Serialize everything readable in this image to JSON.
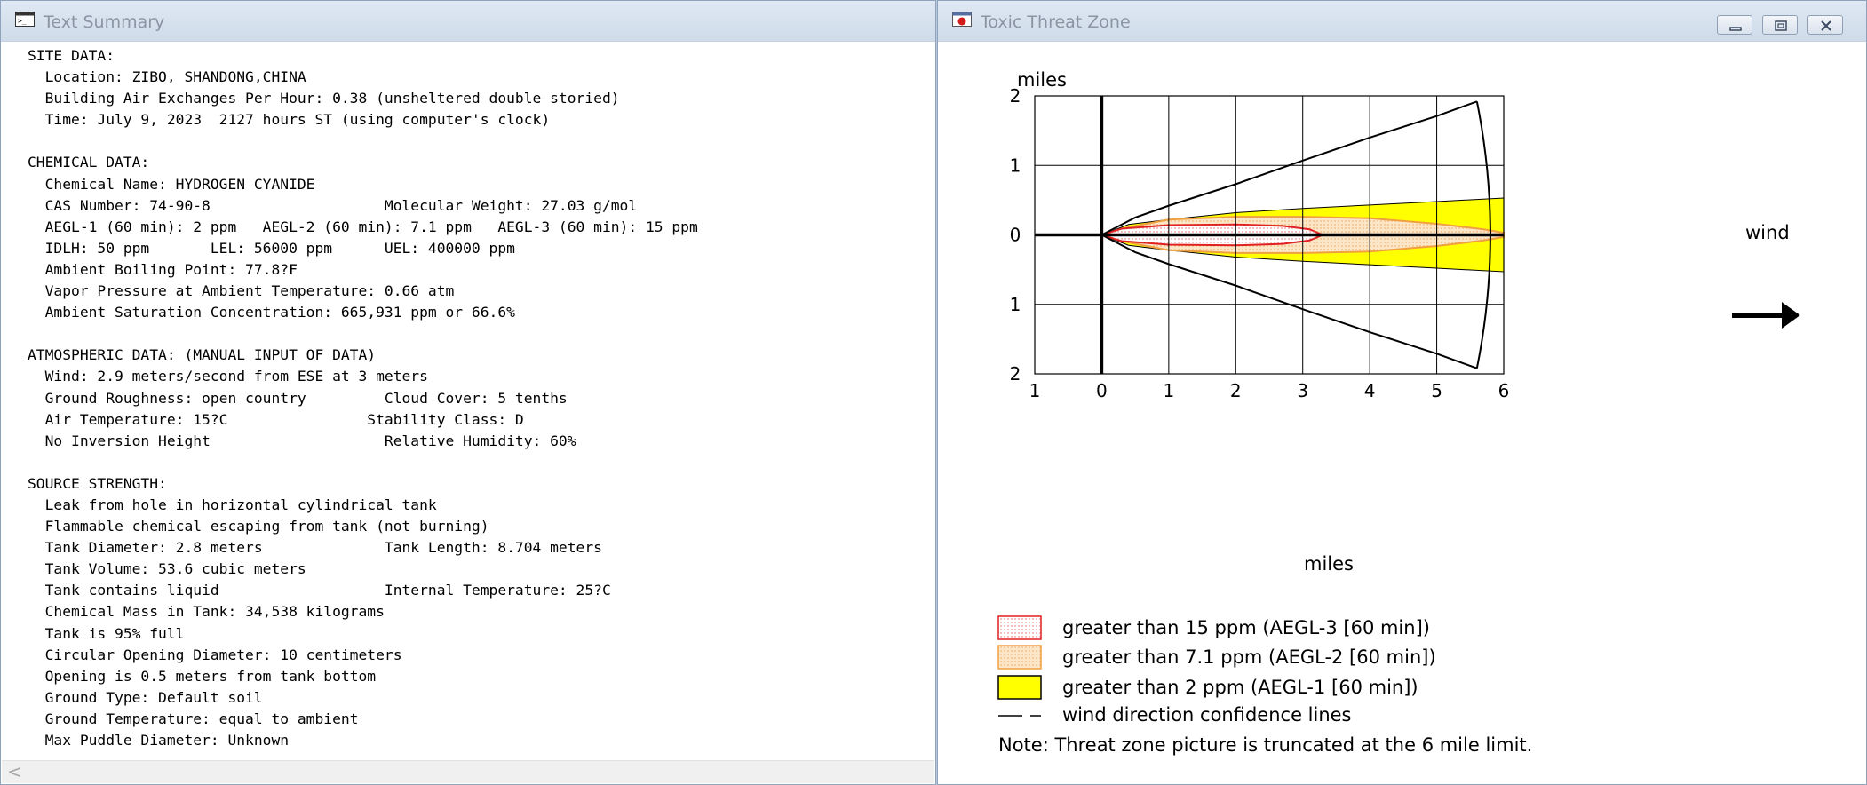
{
  "left_window": {
    "title": "Text Summary",
    "report_lines": [
      "SITE DATA:",
      "  Location: ZIBO, SHANDONG,CHINA",
      "  Building Air Exchanges Per Hour: 0.38 (unsheltered double storied)",
      "  Time: July 9, 2023  2127 hours ST (using computer's clock)",
      "",
      "CHEMICAL DATA:",
      "  Chemical Name: HYDROGEN CYANIDE",
      "  CAS Number: 74-90-8                    Molecular Weight: 27.03 g/mol",
      "  AEGL-1 (60 min): 2 ppm   AEGL-2 (60 min): 7.1 ppm   AEGL-3 (60 min): 15 ppm",
      "  IDLH: 50 ppm       LEL: 56000 ppm      UEL: 400000 ppm",
      "  Ambient Boiling Point: 77.8?F",
      "  Vapor Pressure at Ambient Temperature: 0.66 atm",
      "  Ambient Saturation Concentration: 665,931 ppm or 66.6%",
      "",
      "ATMOSPHERIC DATA: (MANUAL INPUT OF DATA)",
      "  Wind: 2.9 meters/second from ESE at 3 meters",
      "  Ground Roughness: open country         Cloud Cover: 5 tenths",
      "  Air Temperature: 15?C                Stability Class: D",
      "  No Inversion Height                    Relative Humidity: 60%",
      "",
      "SOURCE STRENGTH:",
      "  Leak from hole in horizontal cylindrical tank",
      "  Flammable chemical escaping from tank (not burning)",
      "  Tank Diameter: 2.8 meters              Tank Length: 8.704 meters",
      "  Tank Volume: 53.6 cubic meters",
      "  Tank contains liquid                   Internal Temperature: 25?C",
      "  Chemical Mass in Tank: 34,538 kilograms",
      "  Tank is 95% full",
      "  Circular Opening Diameter: 10 centimeters",
      "  Opening is 0.5 meters from tank bottom",
      "  Ground Type: Default soil",
      "  Ground Temperature: equal to ambient",
      "  Max Puddle Diameter: Unknown"
    ],
    "scroll_left_glyph": "<"
  },
  "right_window": {
    "title": "Toxic Threat Zone",
    "window_buttons": [
      "minimize-icon",
      "maximize-icon",
      "close-icon"
    ],
    "wind_label": "wind",
    "note": "Note: Threat zone picture is truncated at the 6 mile limit.",
    "legend": [
      {
        "label": "greater than 15 ppm (AEGL-3 [60 min])",
        "fill": "#ffffff",
        "dots": "#e06060",
        "stroke": "#e02020"
      },
      {
        "label": "greater than 7.1 ppm (AEGL-2 [60 min])",
        "fill": "#fbe7c8",
        "dots": "#f0a050",
        "stroke": "#f0a040"
      },
      {
        "label": "greater than 2 ppm (AEGL-1 [60 min])",
        "fill": "#ffff00",
        "stroke": "#000000"
      },
      {
        "label": "wind direction confidence lines",
        "line": "dashed"
      }
    ]
  },
  "chart_data": {
    "type": "area",
    "xlabel": "miles",
    "ylabel": "miles",
    "xlim": [
      -1,
      6
    ],
    "ylim": [
      -2,
      2
    ],
    "x_ticks": [
      -1,
      0,
      1,
      2,
      3,
      4,
      5,
      6
    ],
    "x_tick_labels": [
      "1",
      "0",
      "1",
      "2",
      "3",
      "4",
      "5",
      "6"
    ],
    "y_ticks": [
      2,
      1,
      0,
      -1,
      -2
    ],
    "y_tick_labels": [
      "2",
      "1",
      "0",
      "1",
      "2"
    ],
    "grid": true,
    "colors": {
      "aegl1": "#ffff00",
      "aegl2_fill": "#fbe7c8",
      "aegl2_line": "#f0a040",
      "aegl3_line": "#e02020"
    },
    "zones": [
      {
        "name": "AEGL-3",
        "threshold_ppm": 15,
        "max_downwind_miles": 3.3,
        "half_width": [
          [
            0,
            0
          ],
          [
            0.3,
            0.09
          ],
          [
            1,
            0.14
          ],
          [
            2,
            0.15
          ],
          [
            2.7,
            0.13
          ],
          [
            3.1,
            0.08
          ],
          [
            3.3,
            0
          ]
        ]
      },
      {
        "name": "AEGL-2",
        "threshold_ppm": 7.1,
        "max_downwind_miles": 6,
        "half_width": [
          [
            0,
            0
          ],
          [
            0.3,
            0.09
          ],
          [
            1,
            0.22
          ],
          [
            2,
            0.26
          ],
          [
            3,
            0.26
          ],
          [
            4,
            0.24
          ],
          [
            5,
            0.16
          ],
          [
            5.7,
            0.08
          ],
          [
            6,
            0.03
          ]
        ]
      },
      {
        "name": "AEGL-1",
        "threshold_ppm": 2,
        "max_downwind_miles": 6,
        "half_width": [
          [
            0,
            0
          ],
          [
            0.4,
            0.15
          ],
          [
            1,
            0.22
          ],
          [
            2,
            0.32
          ],
          [
            3,
            0.38
          ],
          [
            4,
            0.43
          ],
          [
            5,
            0.48
          ],
          [
            6,
            0.53
          ]
        ]
      }
    ],
    "confidence_lines": [
      [
        0,
        0
      ],
      [
        0.5,
        0.25
      ],
      [
        1,
        0.42
      ],
      [
        2,
        0.73
      ],
      [
        3,
        1.07
      ],
      [
        4,
        1.4
      ],
      [
        5,
        1.71
      ],
      [
        5.6,
        1.92
      ]
    ],
    "confidence_arc_end_x": 6
  }
}
